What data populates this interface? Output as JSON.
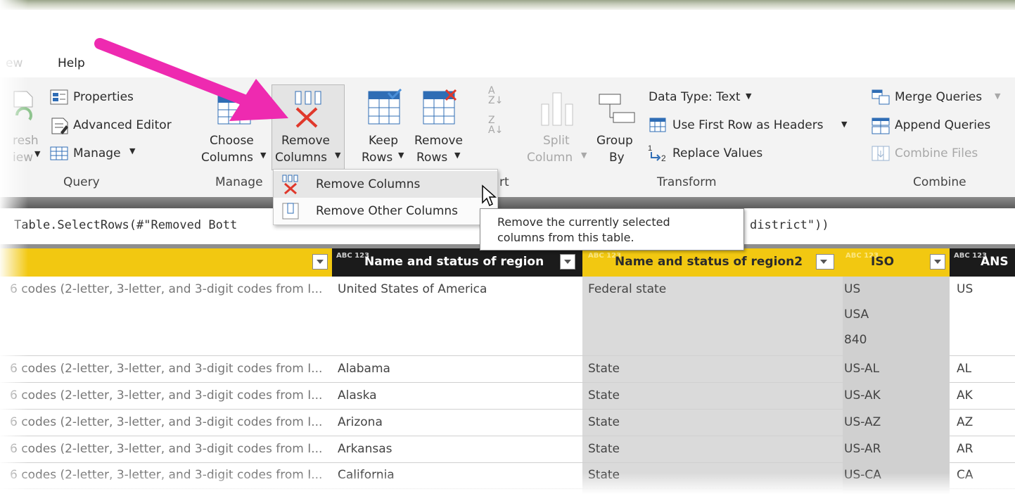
{
  "menu": {
    "view_partial": "ew",
    "help": "Help"
  },
  "ribbon": {
    "query": {
      "refresh_partial_1": "resh",
      "refresh_partial_2": "iew",
      "properties": "Properties",
      "advanced_editor": "Advanced Editor",
      "manage": "Manage",
      "group_label": "Query"
    },
    "manage_group": {
      "choose_columns_1": "Choose",
      "choose_columns_2": "Columns",
      "remove_columns_1": "Remove",
      "remove_columns_2": "Columns",
      "group_label": "Manage"
    },
    "rows": {
      "keep_rows_1": "Keep",
      "keep_rows_2": "Rows",
      "remove_rows_1": "Remove",
      "remove_rows_2": "Rows",
      "group_label_partial": "rt"
    },
    "transform": {
      "split_column_1": "Split",
      "split_column_2": "Column",
      "group_by_1": "Group",
      "group_by_2": "By",
      "data_type": "Data Type: Text",
      "use_first_row": "Use First Row as Headers",
      "replace_values": "Replace Values",
      "group_label": "Transform"
    },
    "combine": {
      "merge_queries": "Merge Queries",
      "append_queries": "Append Queries",
      "combine_files": "Combine Files",
      "group_label": "Combine"
    }
  },
  "dropdown": {
    "remove_columns": "Remove Columns",
    "remove_other_columns": "Remove Other Columns"
  },
  "tooltip": {
    "line1": "Remove the currently selected",
    "line2": "columns from this table."
  },
  "formula": {
    "left": "Table.SelectRows(#\"Removed Bott",
    "right": "district\"))"
  },
  "columns": {
    "col2": {
      "type": "ABC 123",
      "name": "Name and status of region"
    },
    "col3": {
      "type": "ABC 123",
      "name": "Name and status of region2"
    },
    "col4": {
      "type": "ABC 123",
      "name": "ISO"
    },
    "col5": {
      "type": "ABC 123",
      "name": "ANS"
    }
  },
  "rows": [
    {
      "c1": "6 codes (2-letter, 3-letter, and 3-digit codes from I...",
      "c2": "United States of America",
      "c3": "Federal state",
      "c4": [
        "US",
        "USA",
        "840"
      ],
      "c5": "US"
    },
    {
      "c1": "6 codes (2-letter, 3-letter, and 3-digit codes from I...",
      "c2": "Alabama",
      "c3": "State",
      "c4": [
        "US-AL"
      ],
      "c5": "AL"
    },
    {
      "c1": "6 codes (2-letter, 3-letter, and 3-digit codes from I...",
      "c2": "Alaska",
      "c3": "State",
      "c4": [
        "US-AK"
      ],
      "c5": "AK"
    },
    {
      "c1": "6 codes (2-letter, 3-letter, and 3-digit codes from I...",
      "c2": "Arizona",
      "c3": "State",
      "c4": [
        "US-AZ"
      ],
      "c5": "AZ"
    },
    {
      "c1": "6 codes (2-letter, 3-letter, and 3-digit codes from I...",
      "c2": "Arkansas",
      "c3": "State",
      "c4": [
        "US-AR"
      ],
      "c5": "AR"
    },
    {
      "c1": "6 codes (2-letter, 3-letter, and 3-digit codes from I...",
      "c2": "California",
      "c3": "State",
      "c4": [
        "US-CA"
      ],
      "c5": "CA"
    }
  ],
  "colors": {
    "accent_yellow": "#f2c811",
    "arrow_magenta": "#ee2ab0",
    "remove_red": "#e0382b",
    "ribbon_blue": "#2f6db5"
  },
  "icons": [
    "properties-icon",
    "advanced-editor-icon",
    "manage-icon",
    "choose-columns-icon",
    "remove-columns-icon",
    "keep-rows-icon",
    "remove-rows-icon",
    "sort-ascending-icon",
    "sort-descending-icon",
    "split-column-icon",
    "group-by-icon",
    "use-first-row-icon",
    "replace-values-icon",
    "merge-queries-icon",
    "append-queries-icon",
    "combine-files-icon",
    "pointer-arrow-annotation",
    "mouse-cursor-icon"
  ]
}
